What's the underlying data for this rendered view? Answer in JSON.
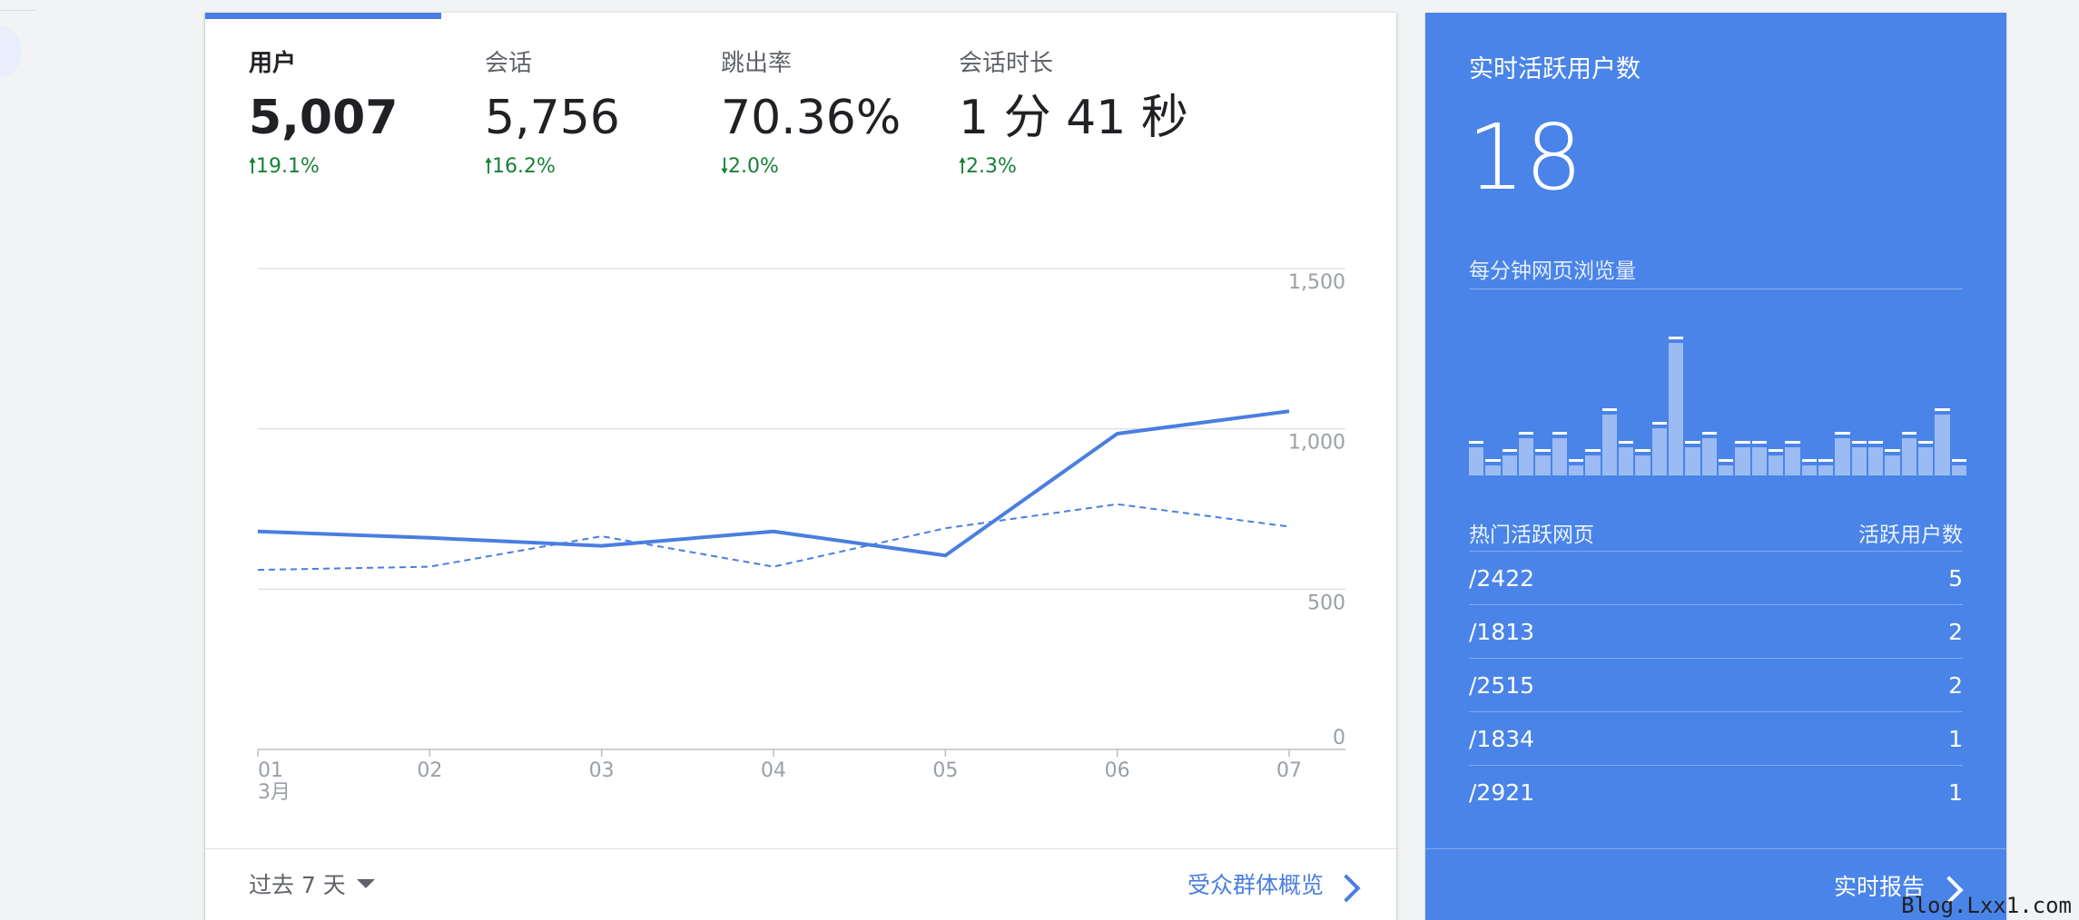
{
  "metrics": [
    {
      "label": "用户",
      "value": "5,007",
      "change": "19.1%",
      "direction": "up"
    },
    {
      "label": "会话",
      "value": "5,756",
      "change": "16.2%",
      "direction": "up"
    },
    {
      "label": "跳出率",
      "value": "70.36%",
      "change": "2.0%",
      "direction": "down"
    },
    {
      "label": "会话时长",
      "value": "1 分 41 秒",
      "change": "2.3%",
      "direction": "up"
    }
  ],
  "arrows": {
    "up": "🠑",
    "down": "🠓"
  },
  "chart_data": {
    "type": "line",
    "x": [
      "01",
      "02",
      "03",
      "04",
      "05",
      "06",
      "07"
    ],
    "x_sublabel": "3月",
    "yticks": [
      "1,500",
      "1,000",
      "500",
      "0"
    ],
    "ylim": [
      0,
      1500
    ],
    "series": [
      {
        "style": "solid",
        "values": [
          680,
          660,
          635,
          680,
          605,
          985,
          1055
        ]
      },
      {
        "style": "dashed",
        "values": [
          560,
          570,
          665,
          570,
          690,
          765,
          695
        ]
      }
    ]
  },
  "footer": {
    "period": "过去 7 天",
    "audience_link": "受众群体概览"
  },
  "realtime": {
    "title": "实时活跃用户数",
    "count": "18",
    "pageviews_label": "每分钟网页浏览量",
    "bars": [
      0.18,
      0.05,
      0.12,
      0.25,
      0.12,
      0.25,
      0.05,
      0.12,
      0.42,
      0.18,
      0.12,
      0.32,
      0.95,
      0.18,
      0.25,
      0.05,
      0.18,
      0.18,
      0.12,
      0.18,
      0.05,
      0.05,
      0.25,
      0.18,
      0.18,
      0.12,
      0.25,
      0.18,
      0.42,
      0.05
    ],
    "col_page": "热门活跃网页",
    "col_users": "活跃用户数",
    "rows": [
      {
        "page": "/2422",
        "users": "5"
      },
      {
        "page": "/1813",
        "users": "2"
      },
      {
        "page": "/2515",
        "users": "2"
      },
      {
        "page": "/1834",
        "users": "1"
      },
      {
        "page": "/2921",
        "users": "1"
      }
    ],
    "report_link": "实时报告"
  },
  "watermark": "Blog.Lxx1.com",
  "colors": {
    "accent": "#4a7ee0",
    "positive": "#188038",
    "realtime_bg": "#4a84e8"
  }
}
